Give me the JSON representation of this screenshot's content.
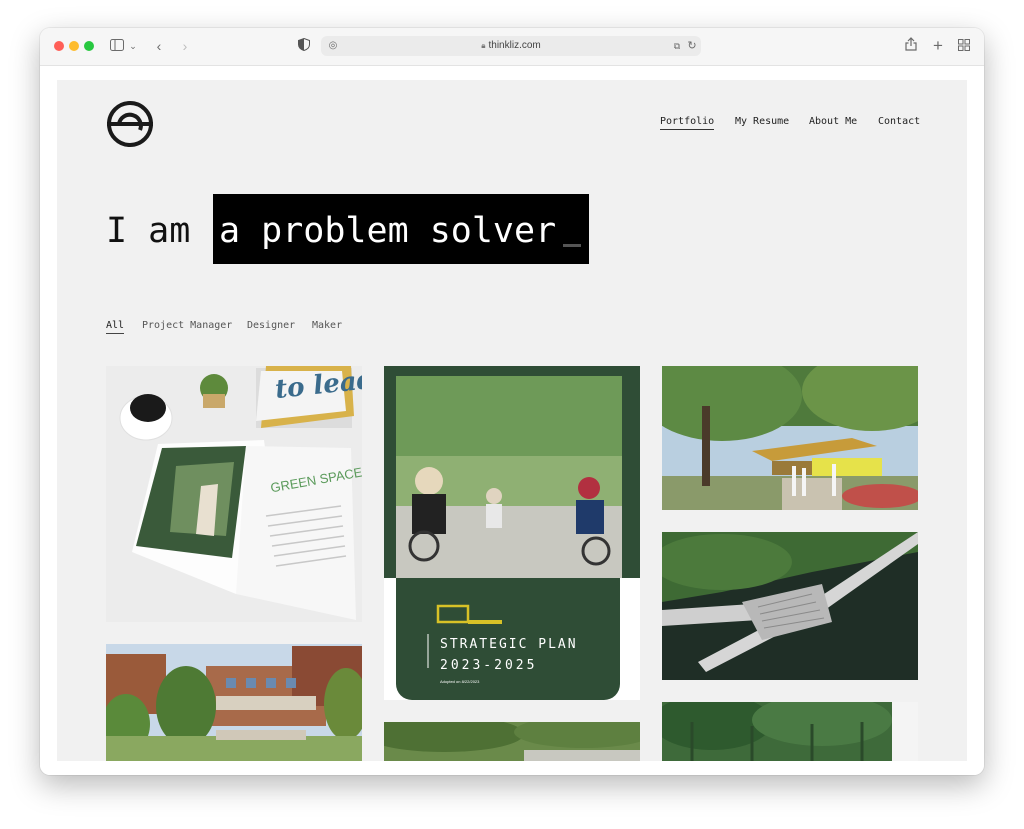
{
  "browser": {
    "url": "thinkliz.com"
  },
  "nav": {
    "items": [
      {
        "label": "Portfolio",
        "active": true
      },
      {
        "label": "My Resume"
      },
      {
        "label": "About Me"
      },
      {
        "label": "Contact"
      }
    ]
  },
  "hero": {
    "prefix": "I am",
    "highlight": "a problem solver"
  },
  "filters": [
    {
      "label": "All",
      "active": true
    },
    {
      "label": "Project Manager"
    },
    {
      "label": "Designer"
    },
    {
      "label": "Maker"
    }
  ],
  "portfolio": {
    "magazine_cover_text": "to lead",
    "magazine_spread_text": "GREEN SPACE",
    "plan_title": "STRATEGIC PLAN",
    "plan_years": "2023-2025",
    "plan_adopted": "Adopted on 8/22/2023"
  },
  "colors": {
    "page_bg": "#f1f1f1",
    "plan_green": "#2f4d36",
    "plan_yellow": "#d8c227",
    "hero_box": "#000000"
  }
}
